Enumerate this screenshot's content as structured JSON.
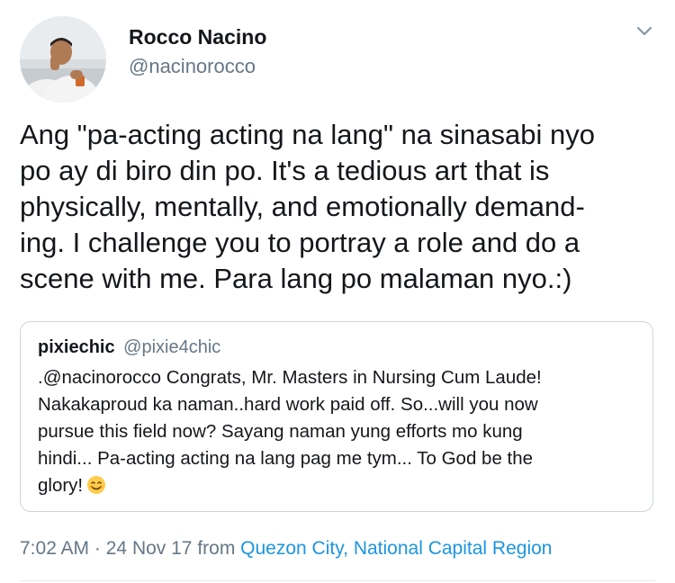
{
  "author": {
    "display_name": "Rocco Nacino",
    "handle": "@nacinorocco"
  },
  "tweet": {
    "lines": [
      "Ang \"pa-acting acting na lang\" na sinasabi nyo",
      "po ay di biro din po. It's a tedious art that is",
      "physically, mentally, and emotionally demand-",
      "ing. I challenge you to portray a role and do a",
      "scene with me. Para lang po malaman nyo.:)"
    ]
  },
  "quoted_tweet": {
    "display_name": "pixiechic",
    "handle": "@pixie4chic",
    "lines": [
      ".@nacinorocco Congrats, Mr. Masters in Nursing Cum Laude!",
      "Nakakaproud ka naman..hard work paid off.  So...will you now",
      "pursue this field now? Sayang naman yung efforts mo kung",
      "hindi... Pa-acting acting na lang pag me tym... To God be the",
      "glory!"
    ],
    "emoji": "smiling-face-with-smiling-eyes"
  },
  "meta": {
    "time": "7:02 AM",
    "separator": "·",
    "date": "24 Nov 17",
    "from_label": "from",
    "location": "Quezon City, National Capital Region"
  },
  "icons": {
    "more": "chevron-down-icon"
  },
  "colors": {
    "link": "#1b95e0",
    "secondary_text": "#657786",
    "border": "#ccd6dd"
  }
}
